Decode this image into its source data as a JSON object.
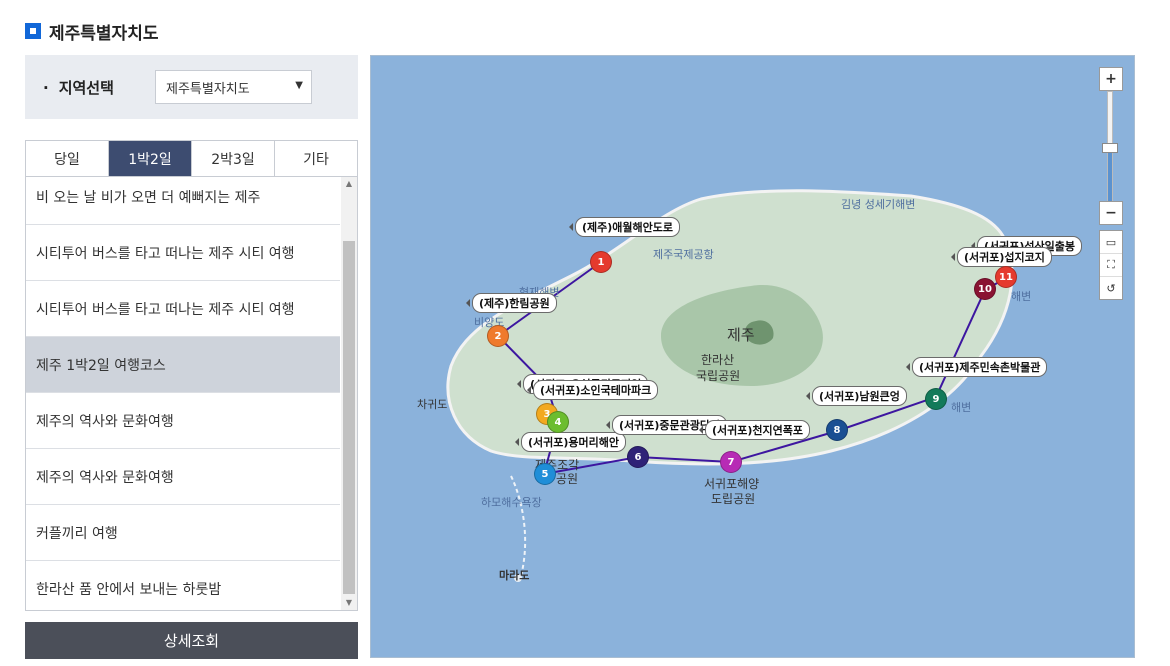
{
  "page": {
    "title": "제주특별자치도"
  },
  "region": {
    "label": "지역선택",
    "selected": "제주특별자치도"
  },
  "tabs": [
    {
      "label": "당일",
      "active": false
    },
    {
      "label": "1박2일",
      "active": true
    },
    {
      "label": "2박3일",
      "active": false
    },
    {
      "label": "기타",
      "active": false
    }
  ],
  "courses": [
    {
      "label": "비 오는 날 비가 오면 더 예뻐지는 제주"
    },
    {
      "label": "시티투어 버스를 타고 떠나는 제주 시티 여행"
    },
    {
      "label": "시티투어 버스를 타고 떠나는 제주 시티 여행"
    },
    {
      "label": "제주 1박2일 여행코스",
      "active": true
    },
    {
      "label": "제주의 역사와 문화여행"
    },
    {
      "label": "제주의 역사와 문화여행"
    },
    {
      "label": "커플끼리 여행"
    },
    {
      "label": "한라산 품 안에서 보내는 하룻밤"
    }
  ],
  "detail_button": "상세조회",
  "map": {
    "places": [
      {
        "text": "(제주)애월해안도로"
      },
      {
        "text": "(제주)한림공원"
      },
      {
        "text": "(서귀포)오설록티뮤지엄"
      },
      {
        "text": "(서귀포)소인국테마파크"
      },
      {
        "text": "(서귀포)용머리해안"
      },
      {
        "text": "(서귀포)중문관광단지"
      },
      {
        "text": "(서귀포)천지연폭포"
      },
      {
        "text": "(서귀포)남원큰엉"
      },
      {
        "text": "(서귀포)제주민속촌박물관"
      },
      {
        "text": "(서귀포)섭지코지"
      },
      {
        "text": "(서귀포)성산일출봉"
      }
    ],
    "markers": [
      {
        "num": "1",
        "color": "#e53a2e"
      },
      {
        "num": "2",
        "color": "#ef7a2c"
      },
      {
        "num": "3",
        "color": "#f2a91f"
      },
      {
        "num": "4",
        "color": "#6cbd2f"
      },
      {
        "num": "5",
        "color": "#1f8ed8"
      },
      {
        "num": "6",
        "color": "#2f2277"
      },
      {
        "num": "7",
        "color": "#b72bb5"
      },
      {
        "num": "8",
        "color": "#1a4f93"
      },
      {
        "num": "9",
        "color": "#137a5a"
      },
      {
        "num": "10",
        "color": "#8a1333"
      },
      {
        "num": "11",
        "color": "#e53a2e"
      }
    ],
    "place_names": {
      "jeju": "제주",
      "hallasan1": "한라산",
      "hallasan2": "국립공원",
      "airport": "제주국제공항",
      "gimnyeong": "김녕 성세기해변",
      "hyeopjae": "협재해변",
      "biyangdo": "비양도",
      "chagwido": "차귀도",
      "seogwipo1": "서귀포해양",
      "seogwipo2": "도립공원",
      "jejugak": "제주조각",
      "jejugak2": "공원",
      "hamo": "하모해수욕장",
      "marado": "마라도",
      "haebyeon1": "해변",
      "haebyeon2": "해변"
    },
    "route_color": "#3d16a0",
    "zoom": {
      "plus": "+",
      "minus": "−"
    },
    "tools": [
      {
        "icon": "ruler-icon"
      },
      {
        "icon": "area-icon"
      },
      {
        "icon": "reset-icon"
      }
    ]
  }
}
